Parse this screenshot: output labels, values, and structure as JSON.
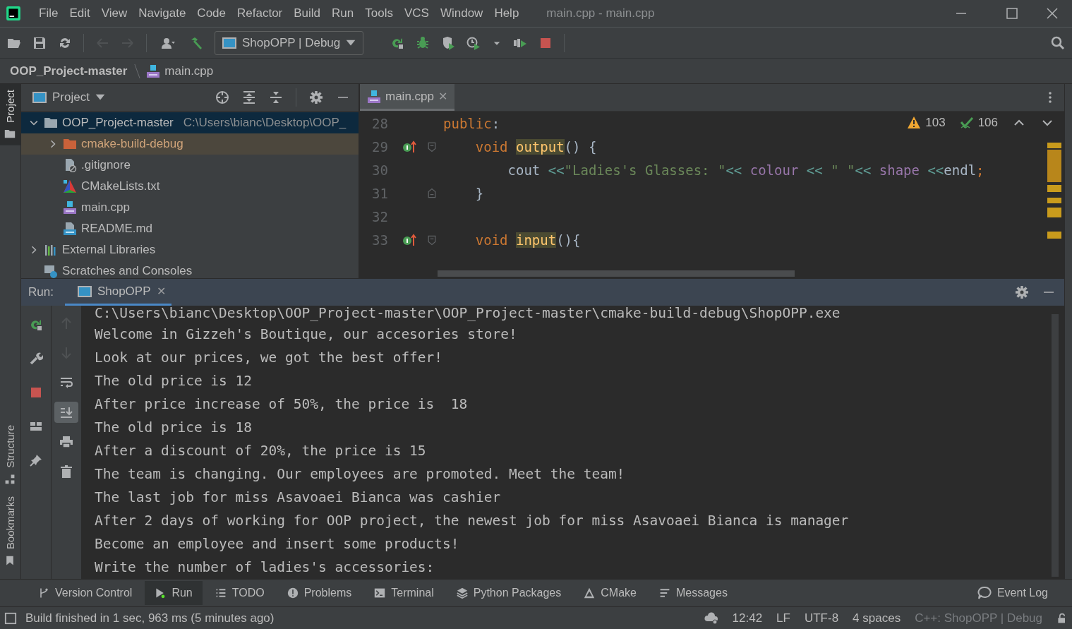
{
  "window": {
    "title": "main.cpp - main.cpp"
  },
  "menu": [
    "File",
    "Edit",
    "View",
    "Navigate",
    "Code",
    "Refactor",
    "Build",
    "Run",
    "Tools",
    "VCS",
    "Window",
    "Help"
  ],
  "toolbar": [
    {
      "kind": "open",
      "disabled": false
    },
    {
      "kind": "save",
      "disabled": false
    },
    {
      "kind": "sync",
      "disabled": false
    },
    {
      "kind": "back",
      "disabled": true
    },
    {
      "kind": "forward",
      "disabled": true
    },
    {
      "kind": "user",
      "disabled": false
    },
    {
      "kind": "build",
      "disabled": false
    }
  ],
  "run_config": {
    "label": "ShopOPP | Debug"
  },
  "run_toolbar": [
    {
      "kind": "rerun"
    },
    {
      "kind": "debug"
    },
    {
      "kind": "coverage"
    },
    {
      "kind": "profile"
    },
    {
      "kind": "attach"
    },
    {
      "kind": "stop"
    }
  ],
  "breadcrumb": [
    {
      "label": "OOP_Project-master",
      "kind": "project"
    },
    {
      "label": "main.cpp",
      "kind": "cpp"
    }
  ],
  "side_tabs": [
    {
      "label": "Project",
      "kind": "project",
      "selected": true
    },
    {
      "label": "Structure",
      "kind": "structure",
      "selected": false
    },
    {
      "label": "Bookmarks",
      "kind": "bookmarks",
      "selected": false
    }
  ],
  "project_panel": {
    "title": "Project",
    "tree": [
      {
        "label": "OOP_Project-master",
        "path": "C:\\Users\\bianc\\Desktop\\OOP_",
        "kind": "module",
        "expanded": true,
        "selected": true,
        "hovered": false,
        "children": [
          {
            "label": "cmake-build-debug",
            "kind": "excluded-folder",
            "expanded": false,
            "selected": false,
            "hovered": true
          },
          {
            "label": ".gitignore",
            "kind": "ignore",
            "selected": false,
            "hovered": false
          },
          {
            "label": "CMakeLists.txt",
            "kind": "cmake",
            "selected": false,
            "hovered": false
          },
          {
            "label": "main.cpp",
            "kind": "cpp",
            "selected": false,
            "hovered": false
          },
          {
            "label": "README.md",
            "kind": "md",
            "selected": false,
            "hovered": false
          }
        ]
      },
      {
        "label": "External Libraries",
        "kind": "libraries",
        "expanded": false,
        "selected": false,
        "hovered": false
      },
      {
        "label": "Scratches and Consoles",
        "kind": "scratches",
        "selected": false,
        "hovered": false
      }
    ]
  },
  "editor": {
    "tabs": [
      {
        "label": "main.cpp",
        "kind": "cpp",
        "close": "✕",
        "selected": true
      }
    ],
    "warnings": "103",
    "passed": "106",
    "lines": [
      {
        "number": "28",
        "implements": false,
        "fold_open": false,
        "fold_close": false,
        "tokens": [
          {
            "text": "public",
            "kind": "keyword"
          },
          {
            "text": ":",
            "kind": "plain"
          }
        ]
      },
      {
        "number": "29",
        "implements": true,
        "fold_open": true,
        "fold_close": false,
        "tokens": [
          {
            "text": "    void ",
            "kind": "keyword"
          },
          {
            "text": "output",
            "kind": "usage"
          },
          {
            "text": "() {",
            "kind": "plain"
          }
        ]
      },
      {
        "number": "30",
        "implements": false,
        "fold_open": false,
        "fold_close": false,
        "tokens": [
          {
            "text": "        cout ",
            "kind": "plain"
          },
          {
            "text": "<<",
            "kind": "operator"
          },
          {
            "text": "\"Ladies's Glasses: \"",
            "kind": "string"
          },
          {
            "text": "<< ",
            "kind": "operator"
          },
          {
            "text": "colour",
            "kind": "field"
          },
          {
            "text": " << ",
            "kind": "operator"
          },
          {
            "text": "\" \"",
            "kind": "string"
          },
          {
            "text": "<< ",
            "kind": "operator"
          },
          {
            "text": "shape",
            "kind": "field"
          },
          {
            "text": " <<",
            "kind": "operator"
          },
          {
            "text": "endl",
            "kind": "plain"
          },
          {
            "text": ";",
            "kind": "keyword"
          }
        ]
      },
      {
        "number": "31",
        "implements": false,
        "fold_open": false,
        "fold_close": true,
        "tokens": [
          {
            "text": "    }",
            "kind": "plain"
          }
        ]
      },
      {
        "number": "32",
        "implements": false,
        "fold_open": false,
        "fold_close": false
      },
      {
        "number": "33",
        "implements": true,
        "fold_open": true,
        "fold_close": false,
        "tokens": [
          {
            "text": "    void ",
            "kind": "keyword"
          },
          {
            "text": "input",
            "kind": "usage"
          },
          {
            "text": "(){",
            "kind": "plain"
          }
        ]
      }
    ]
  },
  "run": {
    "label": "Run:",
    "tabs": [
      {
        "label": "ShopOPP",
        "close": "✕",
        "selected": true
      }
    ],
    "tools_left": [
      {
        "kind": "rerun",
        "selected": false,
        "disabled": false
      },
      {
        "kind": "wrench",
        "selected": false,
        "disabled": false
      },
      {
        "kind": "stop",
        "selected": false,
        "disabled": false
      },
      {
        "kind": "layout",
        "selected": false,
        "disabled": false
      },
      {
        "kind": "pin",
        "selected": false,
        "disabled": false
      }
    ],
    "tools_right": [
      {
        "kind": "up",
        "selected": false,
        "disabled": true
      },
      {
        "kind": "down",
        "selected": false,
        "disabled": true
      },
      {
        "kind": "wrap",
        "selected": false,
        "disabled": false
      },
      {
        "kind": "scroll-end",
        "selected": true,
        "disabled": false
      },
      {
        "kind": "print",
        "selected": false,
        "disabled": false
      },
      {
        "kind": "trash",
        "selected": false,
        "disabled": false
      }
    ],
    "output": [
      "C:\\Users\\bianc\\Desktop\\OOP_Project-master\\OOP_Project-master\\cmake-build-debug\\ShopOPP.exe",
      "Welcome in Gizzeh's Boutique, our accesories store!",
      "Look at our prices, we got the best offer!",
      "The old price is 12",
      "After price increase of 50%, the price is  18",
      "The old price is 18",
      "After a discount of 20%, the price is 15",
      "The team is changing. Our employees are promoted. Meet the team!",
      "The last job for miss Asavoaei Bianca was cashier",
      "After 2 days of working for OOP project, the newest job for miss Asavoaei Bianca is manager",
      "Become an employee and insert some products!",
      "Write the number of ladies's accessories:"
    ]
  },
  "tool_windows": [
    {
      "label": "Version Control",
      "kind": "vcs",
      "selected": false
    },
    {
      "label": "Run",
      "kind": "run",
      "selected": true
    },
    {
      "label": "TODO",
      "kind": "todo",
      "selected": false
    },
    {
      "label": "Problems",
      "kind": "problems",
      "selected": false
    },
    {
      "label": "Terminal",
      "kind": "terminal",
      "selected": false
    },
    {
      "label": "Python Packages",
      "kind": "packages",
      "selected": false
    },
    {
      "label": "CMake",
      "kind": "cmake",
      "selected": false
    },
    {
      "label": "Messages",
      "kind": "messages",
      "selected": false
    }
  ],
  "event_log": {
    "label": "Event Log"
  },
  "status": {
    "message": "Build finished in 1 sec, 963 ms (5 minutes ago)",
    "items": [
      {
        "label": "12:42",
        "disabled": false
      },
      {
        "label": "LF",
        "disabled": false
      },
      {
        "label": "UTF-8",
        "disabled": false
      },
      {
        "label": "4 spaces",
        "disabled": false
      },
      {
        "label": "C++: ShopOPP | Debug",
        "disabled": true
      }
    ]
  }
}
